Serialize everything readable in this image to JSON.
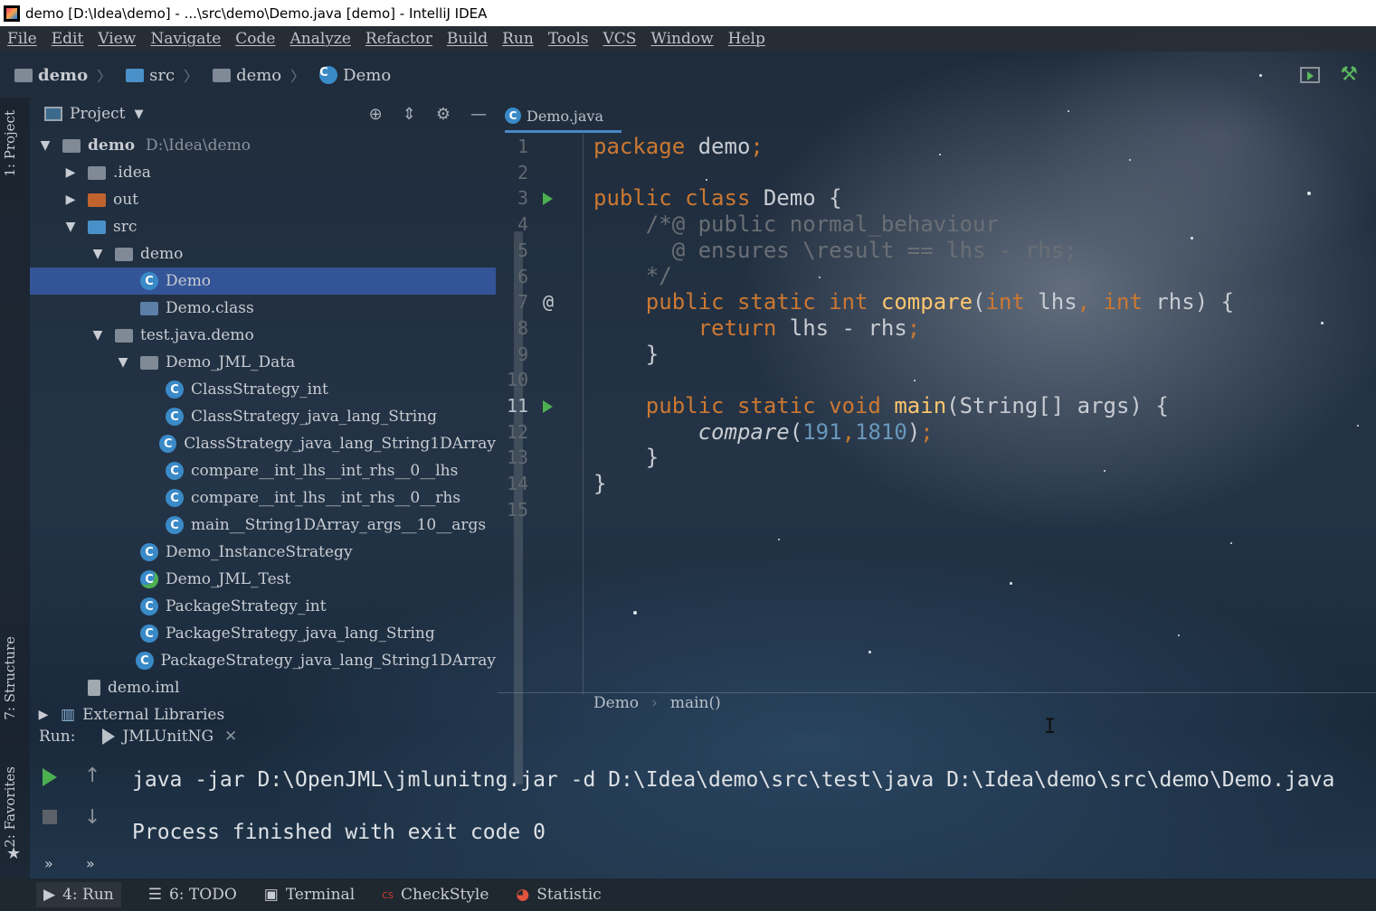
{
  "window": {
    "title": "demo [D:\\Idea\\demo] - ...\\src\\demo\\Demo.java [demo] - IntelliJ IDEA"
  },
  "menu": [
    "File",
    "Edit",
    "View",
    "Navigate",
    "Code",
    "Analyze",
    "Refactor",
    "Build",
    "Run",
    "Tools",
    "VCS",
    "Window",
    "Help"
  ],
  "breadcrumbs": [
    "demo",
    "src",
    "demo",
    "Demo"
  ],
  "side_tabs": {
    "project": "1: Project",
    "structure": "7: Structure",
    "favorites": "2: Favorites"
  },
  "project_panel": {
    "title": "Project",
    "tree": [
      {
        "label": "demo",
        "path": "D:\\Idea\\demo",
        "icon": "module-folder-icon",
        "expanded": true,
        "bold": true
      },
      {
        "label": ".idea",
        "icon": "folder-icon",
        "expanded": false
      },
      {
        "label": "out",
        "icon": "folder-orange-icon",
        "expanded": false
      },
      {
        "label": "src",
        "icon": "folder-blue-icon",
        "expanded": true
      },
      {
        "label": "demo",
        "icon": "package-icon",
        "expanded": true
      },
      {
        "label": "Demo",
        "icon": "class-icon",
        "selected": true
      },
      {
        "label": "Demo.class",
        "icon": "class-file-icon"
      },
      {
        "label": "test.java.demo",
        "icon": "package-icon",
        "expanded": true
      },
      {
        "label": "Demo_JML_Data",
        "icon": "package-icon",
        "expanded": true
      },
      {
        "label": "ClassStrategy_int",
        "icon": "class-icon"
      },
      {
        "label": "ClassStrategy_java_lang_String",
        "icon": "class-icon"
      },
      {
        "label": "ClassStrategy_java_lang_String1DArray",
        "icon": "class-icon"
      },
      {
        "label": "compare__int_lhs__int_rhs__0__lhs",
        "icon": "class-icon"
      },
      {
        "label": "compare__int_lhs__int_rhs__0__rhs",
        "icon": "class-icon"
      },
      {
        "label": "main__String1DArray_args__10__args",
        "icon": "class-icon"
      },
      {
        "label": "Demo_InstanceStrategy",
        "icon": "class-icon"
      },
      {
        "label": "Demo_JML_Test",
        "icon": "test-class-icon"
      },
      {
        "label": "PackageStrategy_int",
        "icon": "class-icon"
      },
      {
        "label": "PackageStrategy_java_lang_String",
        "icon": "class-icon"
      },
      {
        "label": "PackageStrategy_java_lang_String1DArray",
        "icon": "class-icon"
      },
      {
        "label": "demo.iml",
        "icon": "iml-file-icon"
      },
      {
        "label": "External Libraries",
        "icon": "libraries-icon",
        "expanded": false
      }
    ]
  },
  "editor": {
    "tab": "Demo.java",
    "line_numbers": [
      "1",
      "2",
      "3",
      "4",
      "5",
      "6",
      "7",
      "8",
      "9",
      "10",
      "11",
      "12",
      "13",
      "14",
      "15"
    ],
    "lines": [
      [
        {
          "t": "package ",
          "c": "kw"
        },
        {
          "t": "demo",
          "c": "pl"
        },
        {
          "t": ";",
          "c": "kw"
        }
      ],
      [],
      [
        {
          "t": "public class ",
          "c": "kw"
        },
        {
          "t": "Demo {",
          "c": "pl"
        }
      ],
      [
        {
          "t": "    /*@ public normal_behaviour",
          "c": "cm"
        }
      ],
      [
        {
          "t": "      @ ensures \\result == lhs - rhs;",
          "c": "cm"
        }
      ],
      [
        {
          "t": "    */",
          "c": "cm"
        }
      ],
      [
        {
          "t": "    public static int ",
          "c": "kw"
        },
        {
          "t": "compare",
          "c": "fn"
        },
        {
          "t": "(",
          "c": "pl"
        },
        {
          "t": "int ",
          "c": "kw"
        },
        {
          "t": "lhs",
          "c": "pl"
        },
        {
          "t": ", ",
          "c": "kw"
        },
        {
          "t": "int ",
          "c": "kw"
        },
        {
          "t": "rhs) {",
          "c": "pl"
        }
      ],
      [
        {
          "t": "        return ",
          "c": "kw"
        },
        {
          "t": "lhs - rhs",
          "c": "pl"
        },
        {
          "t": ";",
          "c": "kw"
        }
      ],
      [
        {
          "t": "    }",
          "c": "pl"
        }
      ],
      [],
      [
        {
          "t": "    public static void ",
          "c": "kw"
        },
        {
          "t": "main",
          "c": "fn"
        },
        {
          "t": "(String[] args) {",
          "c": "pl"
        }
      ],
      [
        {
          "t": "        ",
          "c": "pl"
        },
        {
          "t": "compare",
          "c": "it"
        },
        {
          "t": "(",
          "c": "pl"
        },
        {
          "t": "191",
          "c": "num"
        },
        {
          "t": ",",
          "c": "kw"
        },
        {
          "t": "1810",
          "c": "num"
        },
        {
          "t": ")",
          "c": "pl"
        },
        {
          "t": ";",
          "c": "kw"
        }
      ],
      [
        {
          "t": "    }",
          "c": "pl"
        }
      ],
      [
        {
          "t": "}",
          "c": "pl"
        }
      ],
      []
    ],
    "breadcrumb": [
      "Demo",
      "main()"
    ]
  },
  "run_panel": {
    "label": "Run:",
    "tab": "JMLUnitNG",
    "output": [
      "java -jar D:\\OpenJML\\jmlunitng.jar -d D:\\Idea\\demo\\src\\test\\java D:\\Idea\\demo\\src\\demo\\Demo.java",
      "Process finished with exit code 0"
    ]
  },
  "bottom_tabs": [
    {
      "label": "4: Run",
      "icon": "run-icon"
    },
    {
      "label": "6: TODO",
      "icon": "todo-icon"
    },
    {
      "label": "Terminal",
      "icon": "terminal-icon"
    },
    {
      "label": "CheckStyle",
      "icon": "checkstyle-icon"
    },
    {
      "label": "Statistic",
      "icon": "statistic-icon"
    }
  ],
  "colors": {
    "keyword": "#cc7832",
    "function": "#ffc66d",
    "number": "#6897bb",
    "comment": "#6a6f75",
    "selection": "#3a60b4"
  }
}
